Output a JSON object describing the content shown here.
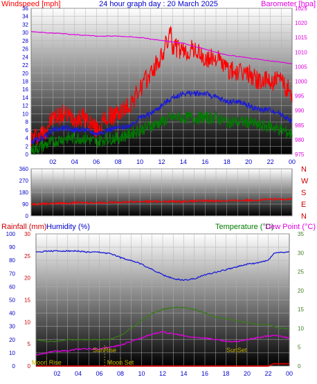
{
  "colors": {
    "wind": "#ff0000",
    "wind_avg": "#1a1ad6",
    "wind_low": "#007a00",
    "baro": "#e000e0",
    "humidity": "#1a1ad6",
    "temperature": "#3a7a1a",
    "dewpoint": "#e000e0",
    "rain": "#cc0000",
    "astro": "#c8b400",
    "left_axis": "#0000cc",
    "panel_bg_top": "#ffffff",
    "panel_bg_bottom": "#000000"
  },
  "chart_data": [
    {
      "type": "line",
      "title": "24 hour graph day : 20 March 2025",
      "ylabel": "Windspeed [mph]",
      "ylabel_right": "Barometer [hpa]",
      "xlim": [
        0,
        24
      ],
      "x_ticks": [
        "02",
        "04",
        "06",
        "08",
        "10",
        "12",
        "14",
        "16",
        "18",
        "20",
        "22",
        "00"
      ],
      "ylim": [
        0,
        36
      ],
      "y_ticks": [
        "0",
        "2",
        "4",
        "6",
        "8",
        "10",
        "12",
        "14",
        "16",
        "18",
        "20",
        "22",
        "24",
        "26",
        "28",
        "30",
        "32",
        "34",
        "36"
      ],
      "y2lim": [
        975,
        1025
      ],
      "y2_ticks": [
        "975",
        "980",
        "985",
        "990",
        "995",
        "1000",
        "1005",
        "1010",
        "1015",
        "1020",
        "1025"
      ],
      "grid": true,
      "series": [
        {
          "key": "wind_gust",
          "axis": "left",
          "jitter": 2.5,
          "x": [
            0,
            1,
            2,
            3,
            4,
            5,
            6,
            7,
            8,
            9,
            10,
            11,
            12,
            12.8,
            13,
            14,
            15,
            16,
            17,
            18,
            19,
            20,
            21,
            22,
            23,
            24
          ],
          "y": [
            4,
            5,
            9,
            10,
            9,
            9,
            6,
            9,
            10,
            12,
            16,
            20,
            24,
            30,
            27,
            25,
            26,
            23,
            24,
            21,
            20,
            20,
            18,
            18,
            18,
            15
          ]
        },
        {
          "key": "wind_avg",
          "axis": "left",
          "jitter": 0.7,
          "x": [
            0,
            1,
            2,
            3,
            4,
            5,
            6,
            7,
            8,
            9,
            10,
            11,
            12,
            13,
            14,
            15,
            16,
            17,
            18,
            19,
            20,
            21,
            22,
            23,
            24
          ],
          "y": [
            3,
            4,
            6,
            6.5,
            6,
            6,
            5,
            6,
            6.5,
            7,
            9,
            10,
            12,
            14,
            15,
            15,
            15,
            14,
            13,
            13,
            12,
            11,
            11,
            10,
            8
          ]
        },
        {
          "key": "wind_low",
          "axis": "left",
          "jitter": 1.6,
          "x": [
            0,
            1,
            2,
            3,
            4,
            5,
            6,
            7,
            8,
            9,
            10,
            11,
            12,
            13,
            14,
            15,
            16,
            17,
            18,
            19,
            20,
            21,
            22,
            23,
            24
          ],
          "y": [
            1,
            2,
            3,
            4,
            4,
            4,
            3,
            4,
            4,
            5,
            6,
            7,
            8,
            9,
            9,
            9,
            9,
            9,
            8,
            8,
            8,
            7,
            7,
            6,
            5
          ]
        },
        {
          "key": "barometer",
          "axis": "right",
          "jitter": 0.12,
          "x": [
            0,
            2,
            4,
            6,
            8,
            10,
            12,
            14,
            16,
            18,
            20,
            22,
            24
          ],
          "y": [
            1017,
            1016.5,
            1016,
            1015.5,
            1015.5,
            1015,
            1014,
            1013,
            1011,
            1009,
            1008,
            1007,
            1006
          ]
        }
      ]
    },
    {
      "type": "line",
      "xlim": [
        0,
        24
      ],
      "ylim": [
        0,
        360
      ],
      "y_ticks": [
        "0",
        "90",
        "180",
        "270",
        "360"
      ],
      "y2_ticks": [
        "N",
        "E",
        "S",
        "W",
        "N"
      ],
      "grid": true,
      "series": [
        {
          "key": "wind_direction",
          "jitter": 8,
          "x": [
            0,
            2,
            4,
            6,
            8,
            10,
            12,
            14,
            16,
            18,
            20,
            22,
            24
          ],
          "y": [
            90,
            95,
            100,
            100,
            105,
            110,
            110,
            110,
            115,
            115,
            120,
            125,
            130
          ]
        }
      ]
    },
    {
      "type": "line",
      "title_left": "Rainfall (mm)",
      "title_humidity": "Humidity (%)",
      "title_temp": "Temperature (°C)",
      "title_dew": "Dew Point (°C)",
      "xlim": [
        0,
        24
      ],
      "x_ticks": [
        "02",
        "04",
        "06",
        "08",
        "10",
        "12",
        "14",
        "16",
        "18",
        "20",
        "22",
        "00"
      ],
      "humidity_ylim": [
        0,
        100
      ],
      "humidity_ticks": [
        "0",
        "10",
        "20",
        "30",
        "40",
        "50",
        "60",
        "70",
        "80",
        "90",
        "100"
      ],
      "rain_ylim": [
        0,
        30
      ],
      "rain_ticks": [
        "0",
        "5",
        "10",
        "15",
        "20",
        "25",
        "30"
      ],
      "temp_ylim": [
        0,
        35
      ],
      "temp_ticks": [
        "0",
        "5",
        "10",
        "15",
        "20",
        "25",
        "30",
        "35"
      ],
      "grid": true,
      "series": [
        {
          "key": "humidity",
          "axis": "humidity",
          "x": [
            0,
            1,
            2,
            3,
            4,
            5,
            6,
            7,
            7.5,
            8,
            9,
            10,
            11,
            12,
            13,
            14,
            15,
            16,
            17,
            18,
            19,
            20,
            21,
            22,
            22.5,
            23,
            24
          ],
          "y": [
            86,
            87,
            87,
            87,
            87,
            86,
            86,
            85,
            84,
            82,
            80,
            77,
            73,
            69,
            66,
            65,
            66,
            69,
            71,
            73,
            75,
            77,
            78,
            80,
            85,
            86,
            86
          ]
        },
        {
          "key": "temperature",
          "axis": "temp",
          "x": [
            0,
            1,
            2,
            3,
            4,
            5,
            6,
            7,
            8,
            9,
            10,
            11,
            12,
            13,
            14,
            15,
            16,
            17,
            18,
            19,
            20,
            21,
            22,
            23,
            24
          ],
          "y": [
            7,
            6.5,
            6.5,
            7,
            7,
            7,
            7,
            7,
            8,
            10,
            12,
            14,
            15,
            15.5,
            15.5,
            15,
            14,
            13,
            12.5,
            12,
            11.5,
            11,
            11,
            10,
            10
          ]
        },
        {
          "key": "dewpoint",
          "axis": "temp",
          "x": [
            0,
            1,
            2,
            3,
            4,
            5,
            6,
            7,
            8,
            9,
            10,
            11,
            12,
            13,
            14,
            15,
            16,
            17,
            18,
            19,
            20,
            21,
            22,
            23,
            24
          ],
          "y": [
            3,
            3.5,
            4,
            4,
            4.5,
            4.5,
            4.5,
            5,
            5.5,
            6.5,
            7.5,
            8.5,
            9,
            8.5,
            8,
            7.5,
            7.5,
            7,
            6.5,
            6.5,
            7,
            7.5,
            8,
            8,
            7.5
          ]
        },
        {
          "key": "rainfall",
          "axis": "rain",
          "x": [
            0,
            22,
            22.5,
            23,
            24
          ],
          "y": [
            0,
            0,
            0.5,
            0.5,
            0.5
          ]
        }
      ],
      "events": [
        {
          "label": "Moon Rise",
          "x": 1.0
        },
        {
          "label": "SunRise",
          "x": 6.5
        },
        {
          "label": "Moon Set",
          "x": 8.0
        },
        {
          "label": "SunSet",
          "x": 19.0
        }
      ]
    }
  ]
}
